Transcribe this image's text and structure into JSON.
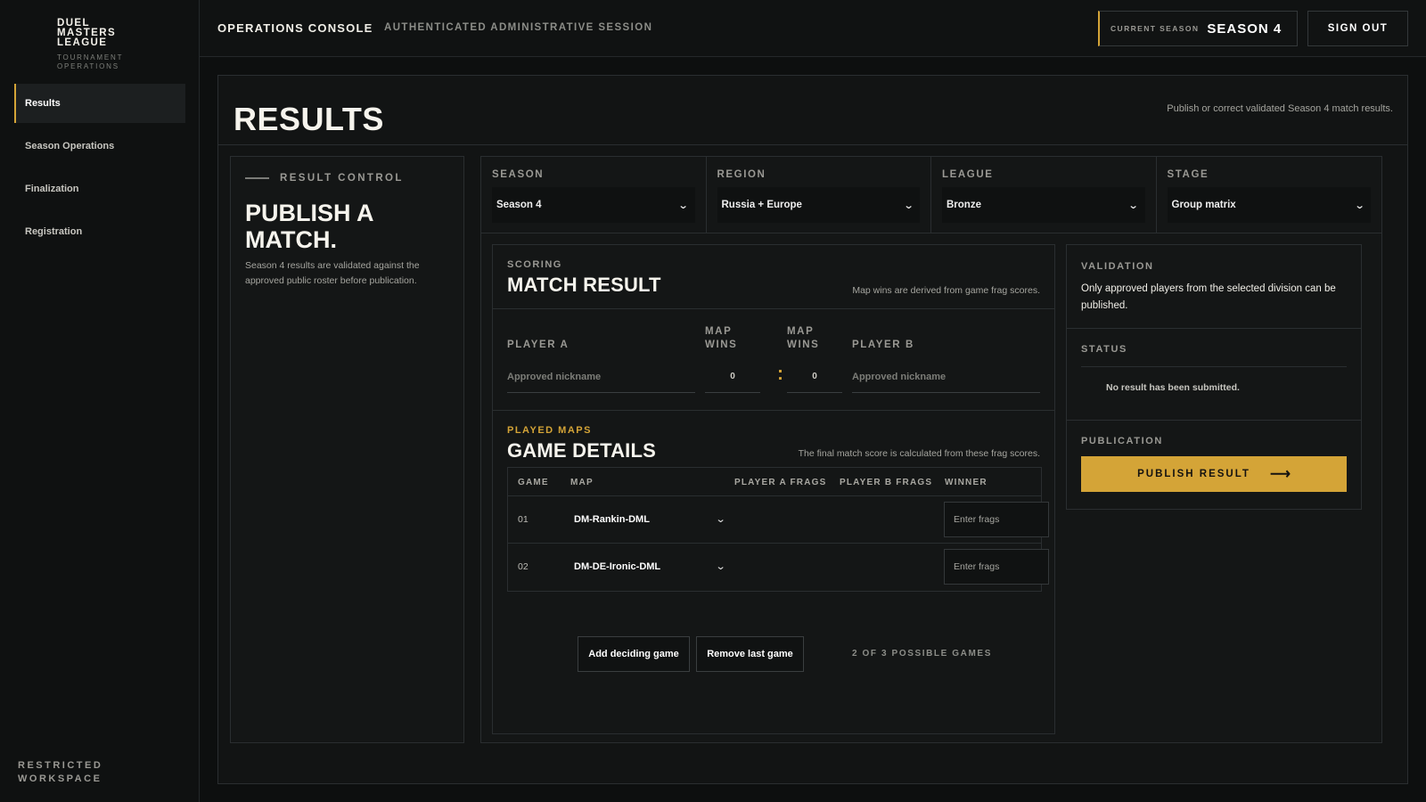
{
  "brand": {
    "name": "DUEL\nMASTERS\nLEAGUE",
    "subtitle": "TOURNAMENT\nOPERATIONS"
  },
  "sidebar": {
    "items": [
      {
        "label": "Results",
        "active": true
      },
      {
        "label": "Season Operations",
        "active": false
      },
      {
        "label": "Finalization",
        "active": false
      },
      {
        "label": "Registration",
        "active": false
      }
    ],
    "footer": "RESTRICTED\nWORKSPACE"
  },
  "topbar": {
    "title": "OPERATIONS CONSOLE",
    "subtitle": "AUTHENTICATED ADMINISTRATIVE SESSION",
    "season_label": "CURRENT SEASON",
    "season_value": "SEASON 4",
    "signout_label": "SIGN OUT"
  },
  "page": {
    "title": "RESULTS",
    "note": "Publish or correct validated Season 4 match results."
  },
  "control": {
    "kicker": "RESULT CONTROL",
    "title": "PUBLISH A\nMATCH.",
    "description": "Season 4 results are validated against the approved public roster before publication."
  },
  "filters": [
    {
      "label": "SEASON",
      "value": "Season 4"
    },
    {
      "label": "REGION",
      "value": "Russia + Europe"
    },
    {
      "label": "LEAGUE",
      "value": "Bronze"
    },
    {
      "label": "STAGE",
      "value": "Group matrix"
    }
  ],
  "match": {
    "kicker": "SCORING",
    "title": "MATCH RESULT",
    "note": "Map wins are derived from game frag scores.",
    "player_a_label": "PLAYER A",
    "player_b_label": "PLAYER B",
    "map_wins_label": "MAP\nWINS",
    "player_a_placeholder": "Approved nickname",
    "player_b_placeholder": "Approved nickname",
    "map_wins_a": "0",
    "map_wins_b": "0",
    "separator": ":"
  },
  "games": {
    "kicker": "PLAYED MAPS",
    "title": "GAME DETAILS",
    "note": "The final match score is calculated from these frag scores.",
    "headers": {
      "game": "GAME",
      "map": "MAP",
      "a_frags": "PLAYER A FRAGS",
      "b_frags": "PLAYER B FRAGS",
      "winner": "WINNER"
    },
    "rows": [
      {
        "num": "01",
        "map": "DM-Rankin-DML",
        "frags_placeholder": "Enter frags"
      },
      {
        "num": "02",
        "map": "DM-DE-Ironic-DML",
        "frags_placeholder": "Enter frags"
      }
    ],
    "add_label": "Add deciding game",
    "remove_label": "Remove last game",
    "count_text": "2 OF 3 POSSIBLE GAMES"
  },
  "side": {
    "validation_label": "VALIDATION",
    "validation_text": "Only approved players from the selected division can be published.",
    "status_label": "STATUS",
    "status_text": "No result has been submitted.",
    "publication_label": "PUBLICATION",
    "publish_label": "PUBLISH RESULT",
    "publish_arrow": "⟶"
  },
  "colors": {
    "accent": "#d4a437",
    "background": "#0d0f0f",
    "panel": "#141616"
  }
}
